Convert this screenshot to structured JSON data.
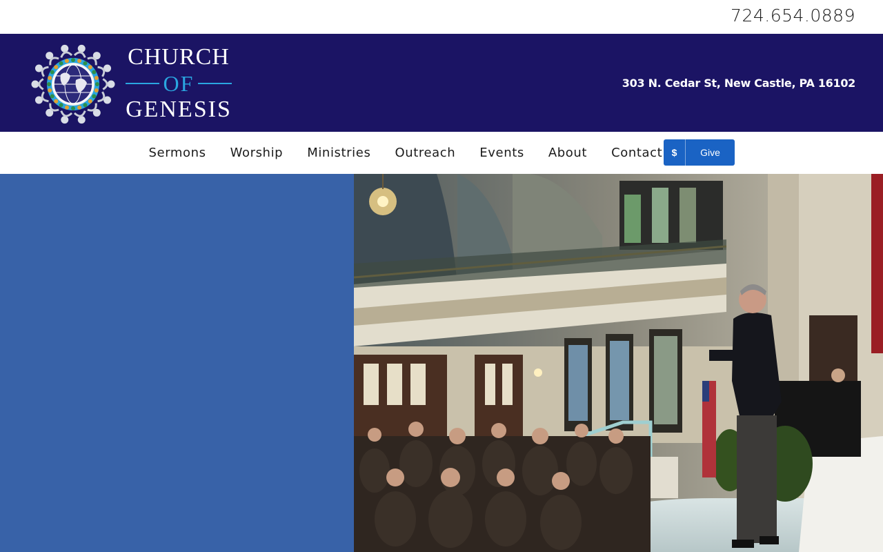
{
  "topbar": {
    "phone": "724.654.0889"
  },
  "header": {
    "logo": {
      "line1": "CHURCH",
      "line2": "OF",
      "line3": "GENESIS"
    },
    "address": "303 N. Cedar St, New Castle, PA 16102"
  },
  "nav": {
    "items": [
      {
        "label": "Sermons"
      },
      {
        "label": "Worship"
      },
      {
        "label": "Ministries"
      },
      {
        "label": "Outreach"
      },
      {
        "label": "Events"
      },
      {
        "label": "About"
      },
      {
        "label": "Contact"
      }
    ],
    "give": {
      "icon": "$",
      "label": "Give"
    }
  },
  "colors": {
    "header_bg": "#1b1464",
    "hero_panel": "#3862a8",
    "give_button": "#1a63c4",
    "logo_accent": "#2aa6e0"
  }
}
